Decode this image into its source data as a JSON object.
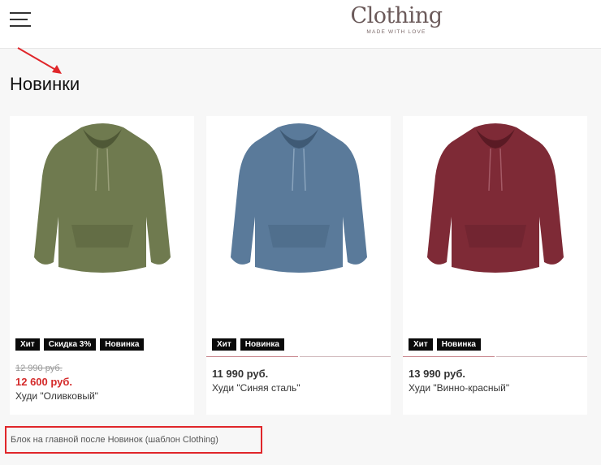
{
  "header": {
    "logo_title": "Clothing",
    "logo_subtitle": "MADE WITH LOVE"
  },
  "section": {
    "title": "Новинки"
  },
  "products": [
    {
      "name": "Худи \"Оливковый\"",
      "old_price": "12 990 руб.",
      "price": "12 600 руб.",
      "badges": [
        "Хит",
        "Скидка 3%",
        "Новинка"
      ],
      "color": "#6f7a4f"
    },
    {
      "name": "Худи \"Синяя сталь\"",
      "price": "11 990 руб.",
      "badges": [
        "Хит",
        "Новинка"
      ],
      "color": "#5a7a9a"
    },
    {
      "name": "Худи \"Винно-красный\"",
      "price": "13 990 руб.",
      "badges": [
        "Хит",
        "Новинка"
      ],
      "color": "#7e2a36"
    }
  ],
  "footer_notice": "Блок на главной после Новинок (шаблон Clothing)",
  "colors": {
    "accent_sale": "#d42a2a",
    "badge_bg": "#0a0a0a",
    "annotation": "#e0262a"
  },
  "icons": [
    "menu-icon",
    "annotation-arrow-icon"
  ]
}
